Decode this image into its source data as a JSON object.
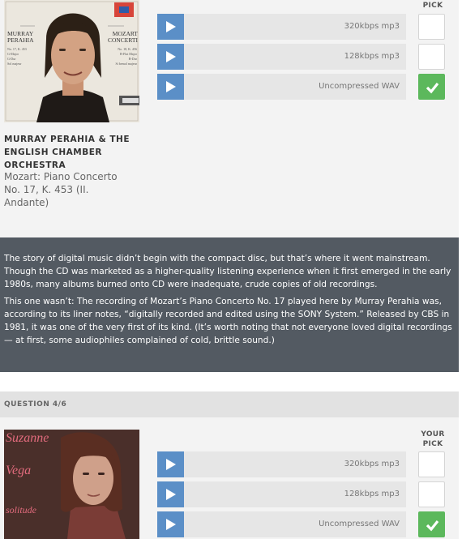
{
  "question3": {
    "pick_header": "PICK",
    "cover_art": {
      "left_text": [
        "MURRAY",
        "PERAHIA"
      ],
      "right_text": [
        "MOZART",
        "CONCERTI"
      ],
      "left_small": [
        "No. 17, K. 453",
        "G-Major",
        "G-Dur",
        "Sol majeur"
      ],
      "right_small": [
        "No. 18, K. 456",
        "B-Flat Major",
        "B-Dur",
        "Si bemol majeur"
      ]
    },
    "tracks": [
      {
        "label": "320kbps mp3",
        "selected": false
      },
      {
        "label": "128kbps mp3",
        "selected": false
      },
      {
        "label": "Uncompressed WAV",
        "selected": true
      }
    ],
    "artist": "MURRAY PERAHIA & THE ENGLISH CHAMBER ORCHESTRA",
    "track_name": "Mozart: Piano Concerto No. 17, K. 453 (II. Andante)"
  },
  "explanation": {
    "paragraph_1": "The story of digital music didn’t begin with the compact disc, but that’s where it went mainstream. Though the CD was marketed as a higher-quality listening experience when it first emerged in the early 1980s, many albums burned onto CD were inadequate, crude copies of old recordings.",
    "paragraph_2": "This one wasn’t: The recording of Mozart’s Piano Concerto No. 17 played here by Murray Perahia was, according to its liner notes, “digitally recorded and edited using the SONY System.” Released by CBS in 1981, it was one of the very first of its kind. (It’s worth noting that not everyone loved digital recordings — at first, some audiophiles complained of cold, brittle sound.)"
  },
  "question4": {
    "header": "QUESTION 4/6",
    "pick_header_line1": "YOUR",
    "pick_header_line2": "PICK",
    "cover_art": {
      "title_1": "Suzanne",
      "title_2": "Vega",
      "title_3": "solitude"
    },
    "tracks": [
      {
        "label": "320kbps mp3",
        "selected": false
      },
      {
        "label": "128kbps mp3",
        "selected": false
      },
      {
        "label": "Uncompressed WAV",
        "selected": true
      }
    ]
  },
  "colors": {
    "play_button": "#5b8fc7",
    "selected_pick": "#5cb85c",
    "info_background": "#535a62",
    "question_bar": "#e2e2e2"
  },
  "icons": {
    "play": "play-icon",
    "check": "checkmark-icon"
  }
}
